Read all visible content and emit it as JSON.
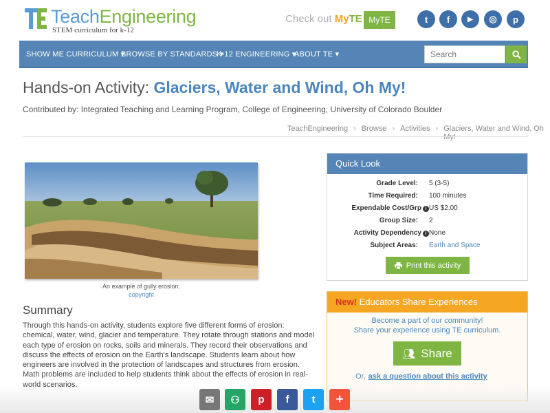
{
  "brand": {
    "name_part1": "Teach",
    "name_part2": "Engineering",
    "tagline": "STEM curriculum for k-12"
  },
  "myte": {
    "prefix": "Check out ",
    "my": "My",
    "te": "TE",
    "button_label": "MyTE"
  },
  "social_top": [
    {
      "icon": "twitter-icon",
      "glyph": "t"
    },
    {
      "icon": "facebook-icon",
      "glyph": "f"
    },
    {
      "icon": "youtube-icon",
      "glyph": "▶"
    },
    {
      "icon": "instagram-icon",
      "glyph": "◎"
    },
    {
      "icon": "pinterest-icon",
      "glyph": "p"
    }
  ],
  "nav": {
    "items": [
      "SHOW ME CURRICULUM",
      "BROWSE BY STANDARDS",
      "K-12 ENGINEERING",
      "ABOUT TE"
    ],
    "search_placeholder": "Search"
  },
  "page": {
    "title_prefix": "Hands-on Activity: ",
    "title": "Glaciers, Water and Wind, Oh My!",
    "contributed_by": "Contributed by: Integrated Teaching and Learning Program, College of Engineering, University of Colorado Boulder"
  },
  "breadcrumb": [
    "TeachEngineering",
    "Browse",
    "Activities",
    "Glaciers, Water and Wind, Oh My!"
  ],
  "image": {
    "caption": "An example of gully erosion.",
    "copyright": "copyright"
  },
  "summary": {
    "heading": "Summary",
    "text": "Through this hands-on activity, students explore five different forms of erosion: chemical, water, wind, glacier and temperature. They rotate through stations and model each type of erosion on rocks, soils and minerals. They record their observations and discuss the effects of erosion on the Earth's landscape. Students learn about how engineers are involved in the protection of landscapes and structures from erosion. Math problems are included to help students think about the effects of erosion in real-world scenarios."
  },
  "quick_look": {
    "heading": "Quick Look",
    "rows": [
      {
        "label": "Grade Level:",
        "value": "5 (3-5)"
      },
      {
        "label": "Time Required:",
        "value": "100 minutes"
      },
      {
        "label": "Expendable Cost/Grp",
        "value": "US $2.00"
      },
      {
        "label": "Group Size:",
        "value": "2"
      },
      {
        "label": "Activity Dependency",
        "value": "None"
      },
      {
        "label": "Subject Areas:",
        "value": "Earth and Space"
      }
    ],
    "print_label": "Print this activity"
  },
  "share": {
    "new_label": "New!",
    "heading": " Educators Share Experiences",
    "line1": "Become a part of our community!",
    "line2": "Share your experience using TE curriculum.",
    "button_label": "Share",
    "or_label": "Or,",
    "ask_label": "ask a question about this activity"
  },
  "bottom_share": [
    {
      "icon": "email-icon",
      "glyph": "✉",
      "color": "#777777"
    },
    {
      "icon": "google-classroom-icon",
      "glyph": "⚇",
      "color": "#25a667"
    },
    {
      "icon": "pinterest-icon",
      "glyph": "p",
      "color": "#cb2027"
    },
    {
      "icon": "facebook-icon",
      "glyph": "f",
      "color": "#3b5998"
    },
    {
      "icon": "twitter-icon",
      "glyph": "t",
      "color": "#1da1f2"
    },
    {
      "icon": "more-share-icon",
      "glyph": "+",
      "color": "#f0553c"
    }
  ],
  "colors": {
    "brand_blue": "#5b9bd5",
    "brand_green": "#7fb542",
    "nav_blue": "#5485b6",
    "share_orange": "#f5a623"
  }
}
